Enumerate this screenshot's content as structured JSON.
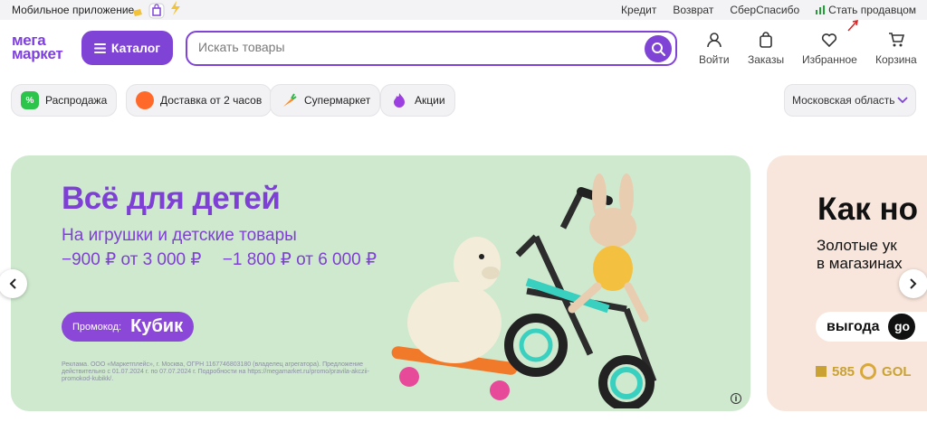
{
  "topbar": {
    "app_label": "Мобильное приложение",
    "links": [
      "Кредит",
      "Возврат",
      "СберСпасибо"
    ],
    "seller_label": "Стать продавцом"
  },
  "header": {
    "logo_line1": "мега",
    "logo_line2": "маркет",
    "catalog_label": "Каталог",
    "search_placeholder": "Искать товары",
    "nav": {
      "login": "Войти",
      "orders": "Заказы",
      "favorites": "Избранное",
      "cart": "Корзина"
    }
  },
  "chips": {
    "sale": "Распродажа",
    "delivery": "Доставка от 2 часов",
    "supermarket": "Супермаркет",
    "promos": "Акции",
    "sale_badge": "%"
  },
  "region": "Московская область",
  "banner_main": {
    "title": "Всё для детей",
    "subtitle": "На игрушки и детские товары",
    "price1": "−900 ₽ от 3 000 ₽",
    "price2": "−1 800 ₽ от 6 000 ₽",
    "promo_label": "Промокод:",
    "promo_code": "Кубик",
    "legal": "Реклама. ООО «Маркетплейс», г. Москва, ОГРН 1167746803180 (владелец агрегатора). Предложение действительно с 01.07.2024 г. по 07.07.2024 г. Подробности на https://megamarket.ru/promo/pravila-akczii-promokod-kubikk/.",
    "info": "i"
  },
  "banner_side": {
    "title": "Как но",
    "text_line1": "Золотые ук",
    "text_line2": "в магазинах",
    "pill": "выгода",
    "pill_tail": "go",
    "brand_num": "585",
    "brand_name": "GOL"
  },
  "colors": {
    "brand": "#7f43d6",
    "banner_bg": "#cfe9cf",
    "side_bg": "#f8e6dc"
  }
}
